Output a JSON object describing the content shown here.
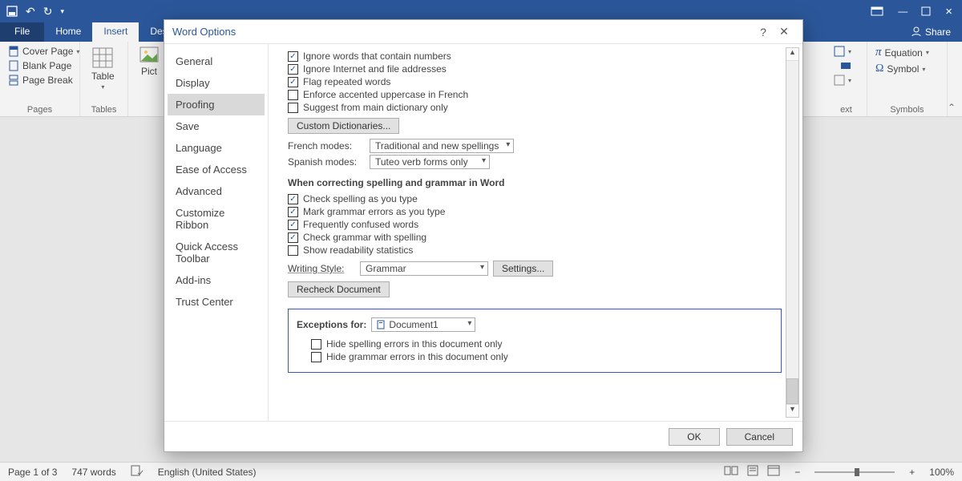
{
  "window": {
    "file_tab": "File",
    "tabs": [
      "Home",
      "Insert",
      "Des"
    ],
    "share": "Share"
  },
  "ribbon": {
    "pages": {
      "cover": "Cover Page",
      "blank": "Blank Page",
      "break": "Page Break",
      "group": "Pages"
    },
    "tables": {
      "table": "Table",
      "group": "Tables"
    },
    "illus": {
      "pict": "Pict"
    },
    "right": {
      "text_group": "ext",
      "equation": "Equation",
      "symbol": "Symbol",
      "symbols_group": "Symbols"
    }
  },
  "status": {
    "page": "Page 1 of 3",
    "words": "747 words",
    "lang": "English (United States)",
    "zoom": "100%"
  },
  "dialog": {
    "title": "Word Options",
    "categories": [
      "General",
      "Display",
      "Proofing",
      "Save",
      "Language",
      "Ease of Access",
      "Advanced",
      "Customize Ribbon",
      "Quick Access Toolbar",
      "Add-ins",
      "Trust Center"
    ],
    "selected_category": "Proofing",
    "opts": {
      "ignore_numbers": "Ignore words that contain numbers",
      "ignore_internet": "Ignore Internet and file addresses",
      "flag_repeated": "Flag repeated words",
      "enforce_french": "Enforce accented uppercase in French",
      "main_dict": "Suggest from main dictionary only",
      "custom_dict_btn": "Custom Dictionaries...",
      "french_label": "French modes:",
      "french_value": "Traditional and new spellings",
      "spanish_label": "Spanish modes:",
      "spanish_value": "Tuteo verb forms only"
    },
    "correcting_header": "When correcting spelling and grammar in Word",
    "corr": {
      "check_spelling": "Check spelling as you type",
      "mark_grammar": "Mark grammar errors as you type",
      "freq_confused": "Frequently confused words",
      "check_grammar": "Check grammar with spelling",
      "readability": "Show readability statistics",
      "writing_style_label": "Writing Style:",
      "writing_style_value": "Grammar",
      "settings_btn": "Settings...",
      "recheck_btn": "Recheck Document"
    },
    "exceptions": {
      "label": "Exceptions for:",
      "doc": "Document1",
      "hide_spelling": "Hide spelling errors in this document only",
      "hide_grammar": "Hide grammar errors in this document only"
    },
    "ok": "OK",
    "cancel": "Cancel"
  }
}
